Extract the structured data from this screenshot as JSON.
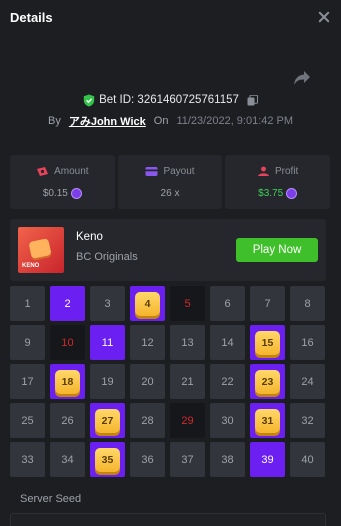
{
  "header": {
    "title": "Details"
  },
  "bet": {
    "id_label": "Bet ID: 3261460725761157",
    "by_label": "By",
    "user": "アみJohn Wick",
    "on_label": "On",
    "date": "11/23/2022, 9:01:42 PM"
  },
  "stats": [
    {
      "label": "Amount",
      "value": "$0.15",
      "icon": "money-icon",
      "color": "#e8435b"
    },
    {
      "label": "Payout",
      "value": "26 x",
      "icon": "card-icon",
      "color": "#8a57f0"
    },
    {
      "label": "Profit",
      "value": "$3.75",
      "icon": "profit-icon",
      "color": "#e8435b"
    }
  ],
  "game": {
    "name": "Keno",
    "provider": "BC Originals",
    "play_label": "Play Now",
    "thumb_text": "KENO",
    "thumb_ball": "1 2"
  },
  "grid": {
    "cells": [
      {
        "n": "1",
        "state": "normal"
      },
      {
        "n": "2",
        "state": "picked"
      },
      {
        "n": "3",
        "state": "normal"
      },
      {
        "n": "4",
        "state": "hit"
      },
      {
        "n": "5",
        "state": "drawn"
      },
      {
        "n": "6",
        "state": "normal"
      },
      {
        "n": "7",
        "state": "normal"
      },
      {
        "n": "8",
        "state": "normal"
      },
      {
        "n": "9",
        "state": "normal"
      },
      {
        "n": "10",
        "state": "drawn"
      },
      {
        "n": "11",
        "state": "picked"
      },
      {
        "n": "12",
        "state": "normal"
      },
      {
        "n": "13",
        "state": "normal"
      },
      {
        "n": "14",
        "state": "normal"
      },
      {
        "n": "15",
        "state": "hit"
      },
      {
        "n": "16",
        "state": "normal"
      },
      {
        "n": "17",
        "state": "normal"
      },
      {
        "n": "18",
        "state": "hit"
      },
      {
        "n": "19",
        "state": "normal"
      },
      {
        "n": "20",
        "state": "normal"
      },
      {
        "n": "21",
        "state": "normal"
      },
      {
        "n": "22",
        "state": "normal"
      },
      {
        "n": "23",
        "state": "hit"
      },
      {
        "n": "24",
        "state": "normal"
      },
      {
        "n": "25",
        "state": "normal"
      },
      {
        "n": "26",
        "state": "normal"
      },
      {
        "n": "27",
        "state": "hit"
      },
      {
        "n": "28",
        "state": "normal"
      },
      {
        "n": "29",
        "state": "drawn"
      },
      {
        "n": "30",
        "state": "normal"
      },
      {
        "n": "31",
        "state": "hit"
      },
      {
        "n": "32",
        "state": "normal"
      },
      {
        "n": "33",
        "state": "normal"
      },
      {
        "n": "34",
        "state": "normal"
      },
      {
        "n": "35",
        "state": "hit"
      },
      {
        "n": "36",
        "state": "normal"
      },
      {
        "n": "37",
        "state": "normal"
      },
      {
        "n": "38",
        "state": "normal"
      },
      {
        "n": "39",
        "state": "picked"
      },
      {
        "n": "40",
        "state": "normal"
      }
    ]
  },
  "seed": {
    "label": "Server Seed"
  },
  "colors": {
    "accent": "#6b1ff0",
    "play": "#3fc02a",
    "profit": "#3fd15a",
    "miss": "#d12a2a",
    "ball": "#f5b52c"
  }
}
